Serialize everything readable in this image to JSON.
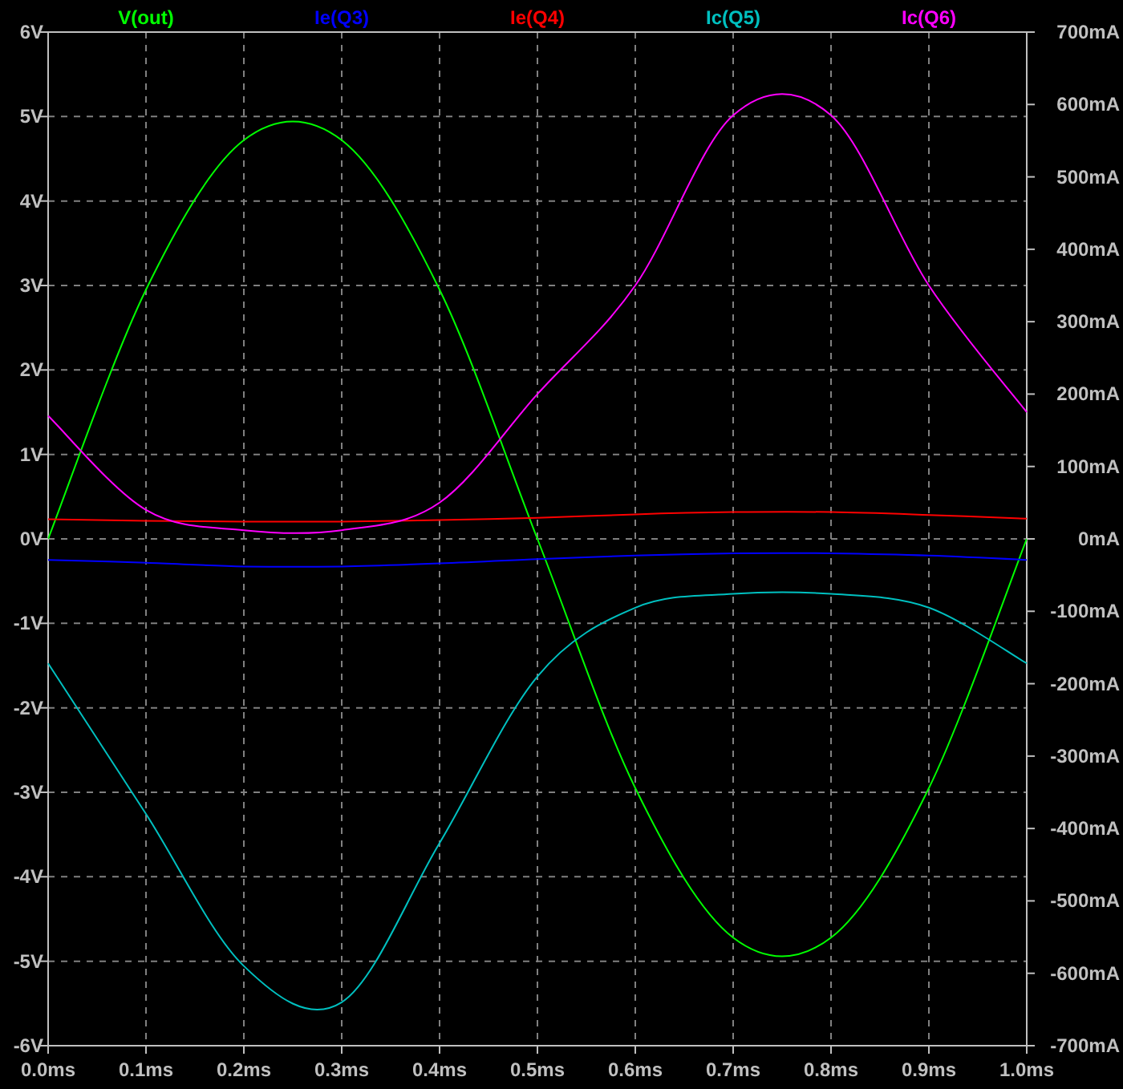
{
  "plot": {
    "chart_data": {
      "type": "line",
      "grid": true,
      "x": [
        0,
        0.1,
        0.2,
        0.3,
        0.4,
        0.5,
        0.6,
        0.7,
        0.8,
        0.9,
        1.0
      ],
      "xlim": [
        0,
        1
      ],
      "xticks": [
        {
          "value": 0,
          "label": "0.0ms"
        },
        {
          "value": 0.1,
          "label": "0.1ms"
        },
        {
          "value": 0.2,
          "label": "0.2ms"
        },
        {
          "value": 0.3,
          "label": "0.3ms"
        },
        {
          "value": 0.4,
          "label": "0.4ms"
        },
        {
          "value": 0.5,
          "label": "0.5ms"
        },
        {
          "value": 0.6,
          "label": "0.6ms"
        },
        {
          "value": 0.7,
          "label": "0.7ms"
        },
        {
          "value": 0.8,
          "label": "0.8ms"
        },
        {
          "value": 0.9,
          "label": "0.9ms"
        },
        {
          "value": 1.0,
          "label": "1.0ms"
        }
      ],
      "ylim": [
        -6,
        6
      ],
      "yticks": [
        {
          "value": 6,
          "label": "6V"
        },
        {
          "value": 5,
          "label": "5V"
        },
        {
          "value": 4,
          "label": "4V"
        },
        {
          "value": 3,
          "label": "3V"
        },
        {
          "value": 2,
          "label": "2V"
        },
        {
          "value": 1,
          "label": "1V"
        },
        {
          "value": 0,
          "label": "0V"
        },
        {
          "value": -1,
          "label": "-1V"
        },
        {
          "value": -2,
          "label": "-2V"
        },
        {
          "value": -3,
          "label": "-3V"
        },
        {
          "value": -4,
          "label": "-4V"
        },
        {
          "value": -5,
          "label": "-5V"
        },
        {
          "value": -6,
          "label": "-6V"
        }
      ],
      "y2lim": [
        -700,
        700
      ],
      "y2ticks": [
        {
          "value": 700,
          "label": "700mA"
        },
        {
          "value": 600,
          "label": "600mA"
        },
        {
          "value": 500,
          "label": "500mA"
        },
        {
          "value": 400,
          "label": "400mA"
        },
        {
          "value": 300,
          "label": "300mA"
        },
        {
          "value": 200,
          "label": "200mA"
        },
        {
          "value": 100,
          "label": "100mA"
        },
        {
          "value": 0,
          "label": "0mA"
        },
        {
          "value": -100,
          "label": "-100mA"
        },
        {
          "value": -200,
          "label": "-200mA"
        },
        {
          "value": -300,
          "label": "-300mA"
        },
        {
          "value": -400,
          "label": "-400mA"
        },
        {
          "value": -500,
          "label": "-500mA"
        },
        {
          "value": -600,
          "label": "-600mA"
        },
        {
          "value": -700,
          "label": "-700mA"
        }
      ],
      "series": [
        {
          "name": "V(out)",
          "color": "#00ff00",
          "axis": "y",
          "values": [
            0,
            2.95,
            4.72,
            4.72,
            2.95,
            0,
            -2.95,
            -4.72,
            -4.72,
            -2.95,
            0
          ]
        },
        {
          "name": "Ie(Q3)",
          "color": "#0000ff",
          "axis": "y2",
          "values": [
            -29,
            -33,
            -38,
            -38,
            -34,
            -28,
            -23,
            -20,
            -20,
            -23,
            -29
          ]
        },
        {
          "name": "Ie(Q4)",
          "color": "#ff0000",
          "axis": "y2",
          "values": [
            27,
            25,
            24,
            24,
            26,
            29,
            34,
            37,
            37,
            33,
            28
          ]
        },
        {
          "name": "Ic(Q5)",
          "color": "#00c0c0",
          "axis": "y2",
          "values": [
            -172,
            -380,
            -590,
            -640,
            -420,
            -190,
            -95,
            -76,
            -76,
            -95,
            -172
          ]
        },
        {
          "name": "Ic(Q6)",
          "color": "#ff00ff",
          "axis": "y2",
          "values": [
            170,
            40,
            12,
            12,
            50,
            200,
            350,
            585,
            585,
            350,
            175
          ]
        }
      ]
    }
  }
}
